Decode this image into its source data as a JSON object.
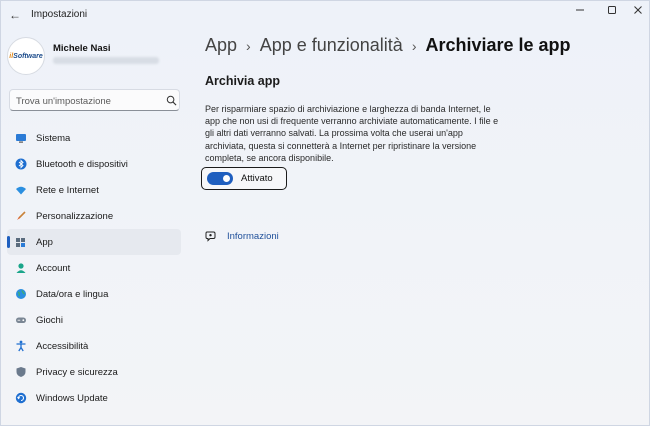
{
  "window": {
    "title": "Impostazioni",
    "back_glyph": "←"
  },
  "profile": {
    "name": "Michele Nasi",
    "avatar_logo_a": "il",
    "avatar_logo_b": "Software"
  },
  "search": {
    "placeholder": "Trova un'impostazione"
  },
  "sidebar": {
    "items": [
      {
        "label": "Sistema",
        "icon": "monitor-icon"
      },
      {
        "label": "Bluetooth e dispositivi",
        "icon": "bluetooth-icon"
      },
      {
        "label": "Rete e Internet",
        "icon": "wifi-icon"
      },
      {
        "label": "Personalizzazione",
        "icon": "brush-icon"
      },
      {
        "label": "App",
        "icon": "apps-icon",
        "active": true
      },
      {
        "label": "Account",
        "icon": "person-icon"
      },
      {
        "label": "Data/ora e lingua",
        "icon": "globe-clock-icon"
      },
      {
        "label": "Giochi",
        "icon": "gamepad-icon"
      },
      {
        "label": "Accessibilità",
        "icon": "accessibility-icon"
      },
      {
        "label": "Privacy e sicurezza",
        "icon": "shield-icon"
      },
      {
        "label": "Windows Update",
        "icon": "update-icon"
      }
    ]
  },
  "breadcrumb": {
    "items": [
      "App",
      "App e funzionalità",
      "Archiviare le app"
    ],
    "separator": "›"
  },
  "main": {
    "section_title": "Archivia app",
    "description": "Per risparmiare spazio di archiviazione e larghezza di banda Internet, le app che non usi di frequente verranno archiviate automaticamente. I file e gli altri dati verranno salvati. La prossima volta che userai un'app archiviata, questa si connetterà a Internet per ripristinare la versione completa, se ancora disponibile.",
    "toggle": {
      "label": "Attivato",
      "on": true
    },
    "info_link": "Informazioni"
  },
  "colors": {
    "accent": "#1f5fbf",
    "link": "#1f4f9a"
  }
}
